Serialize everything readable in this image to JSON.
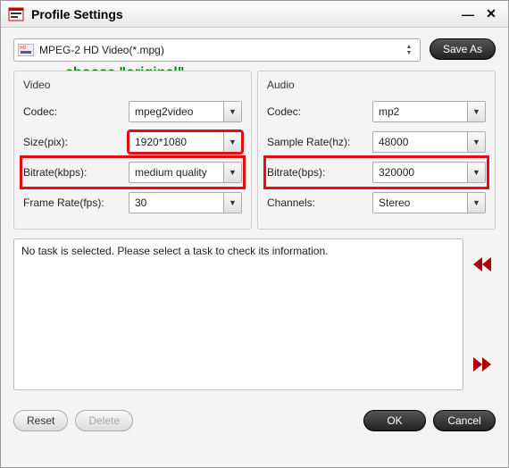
{
  "window": {
    "title": "Profile Settings"
  },
  "toolbar": {
    "profile": "MPEG-2 HD Video(*.mpg)",
    "save_as": "Save As"
  },
  "annotation": {
    "text": "choose \"original\""
  },
  "video": {
    "section": "Video",
    "codec_label": "Codec:",
    "codec": "mpeg2video",
    "size_label": "Size(pix):",
    "size": "1920*1080",
    "bitrate_label": "Bitrate(kbps):",
    "bitrate": "medium quality",
    "fps_label": "Frame Rate(fps):",
    "fps": "30"
  },
  "audio": {
    "section": "Audio",
    "codec_label": "Codec:",
    "codec": "mp2",
    "rate_label": "Sample Rate(hz):",
    "rate": "48000",
    "bitrate_label": "Bitrate(bps):",
    "bitrate": "320000",
    "channels_label": "Channels:",
    "channels": "Stereo"
  },
  "task": {
    "message": "No task is selected. Please select a task to check its information."
  },
  "footer": {
    "reset": "Reset",
    "delete": "Delete",
    "ok": "OK",
    "cancel": "Cancel"
  }
}
